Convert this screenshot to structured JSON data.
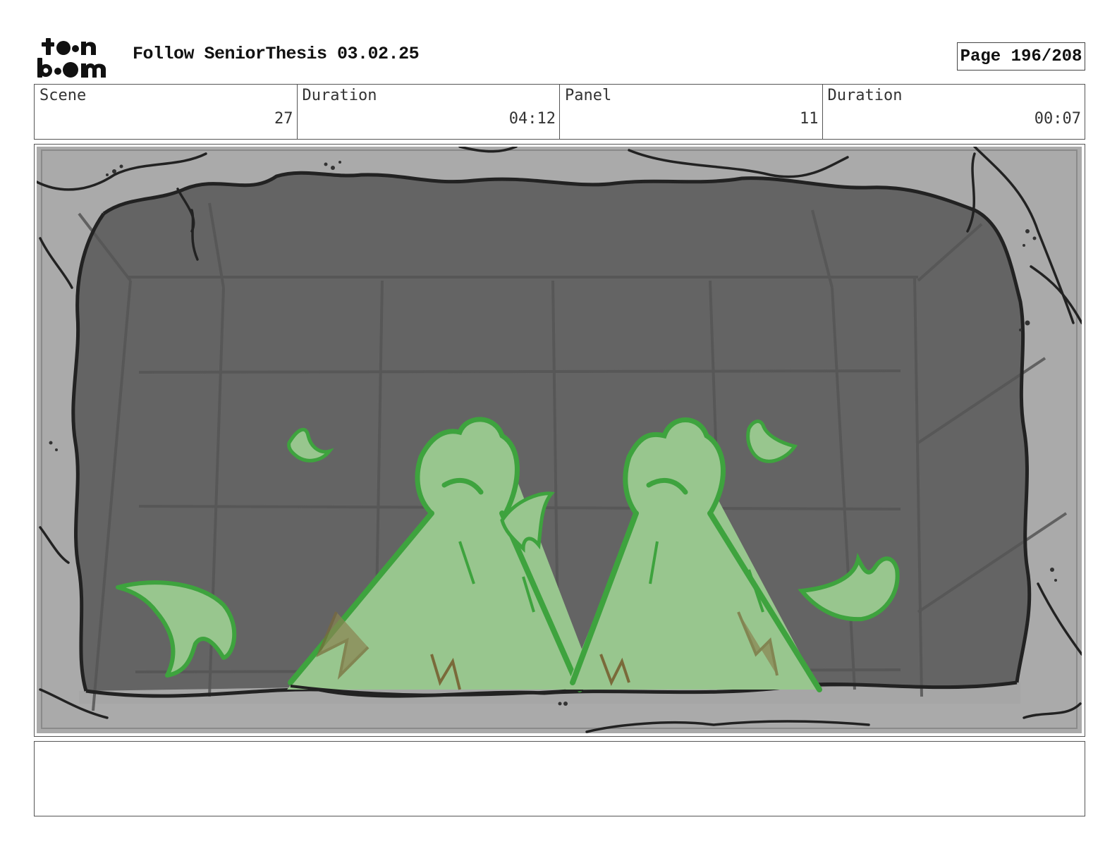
{
  "header": {
    "title": "Follow SeniorThesis 03.02.25",
    "page_label": "Page 196/208"
  },
  "logo": {
    "text": "toon boom",
    "icon": "toon-boom-logo"
  },
  "info": [
    {
      "label": "Scene",
      "value": "27"
    },
    {
      "label": "Duration",
      "value": "04:12"
    },
    {
      "label": "Panel",
      "value": "11"
    },
    {
      "label": "Duration",
      "value": "00:07"
    }
  ],
  "panel": {
    "description_icons": [
      "cave-frame",
      "cone-tree-left",
      "cone-tree-right",
      "leaf"
    ],
    "colors": {
      "frame_light": "#aaaaaa",
      "room_dark": "#646464",
      "grid": "#545454",
      "outline": "#222222",
      "green_fill": "#98c68e",
      "green_line": "#3ea33e",
      "bark": "#8a8452"
    }
  },
  "notes": {
    "text": ""
  }
}
